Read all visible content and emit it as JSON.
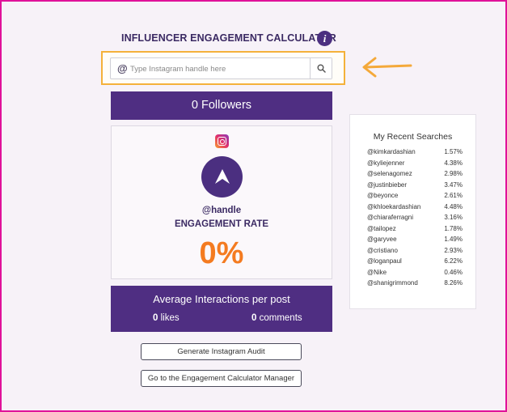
{
  "header": {
    "title": "INFLUENCER ENGAGEMENT CALCULATOR",
    "info_icon": "info-icon"
  },
  "search": {
    "prefix": "@",
    "placeholder": "Type Instagram handle here",
    "value": "",
    "button_icon": "search-icon"
  },
  "followers": {
    "label": "0 Followers"
  },
  "profile": {
    "platform_icon": "instagram-icon",
    "handle": "@handle",
    "engagement_label": "ENGAGEMENT RATE",
    "engagement_value": "0%"
  },
  "interactions": {
    "heading": "Average Interactions per post",
    "likes_count": "0",
    "likes_label": " likes",
    "comments_count": "0",
    "comments_label": " comments"
  },
  "buttons": {
    "audit": "Generate Instagram Audit",
    "manager": "Go to the Engagement Calculator Manager"
  },
  "recent_searches": {
    "title": "My Recent Searches",
    "items": [
      {
        "handle": "@kimkardashian",
        "rate": "1.57%"
      },
      {
        "handle": "@kyliejenner",
        "rate": "4.38%"
      },
      {
        "handle": "@selenagomez",
        "rate": "2.98%"
      },
      {
        "handle": "@justinbieber",
        "rate": "3.47%"
      },
      {
        "handle": "@beyonce",
        "rate": "2.61%"
      },
      {
        "handle": "@khloekardashian",
        "rate": "4.48%"
      },
      {
        "handle": "@chiaraferragni",
        "rate": "3.16%"
      },
      {
        "handle": "@tailopez",
        "rate": "1.78%"
      },
      {
        "handle": "@garyvee",
        "rate": "1.49%"
      },
      {
        "handle": "@cristiano",
        "rate": "2.93%"
      },
      {
        "handle": "@loganpaul",
        "rate": "6.22%"
      },
      {
        "handle": "@Nike",
        "rate": "0.46%"
      },
      {
        "handle": "@shanigrimmond",
        "rate": "8.26%"
      }
    ]
  },
  "colors": {
    "brand_purple": "#4f2e82",
    "accent_orange": "#f47b20",
    "highlight_yellow": "#f4b13a",
    "frame_pink": "#e0129a"
  }
}
